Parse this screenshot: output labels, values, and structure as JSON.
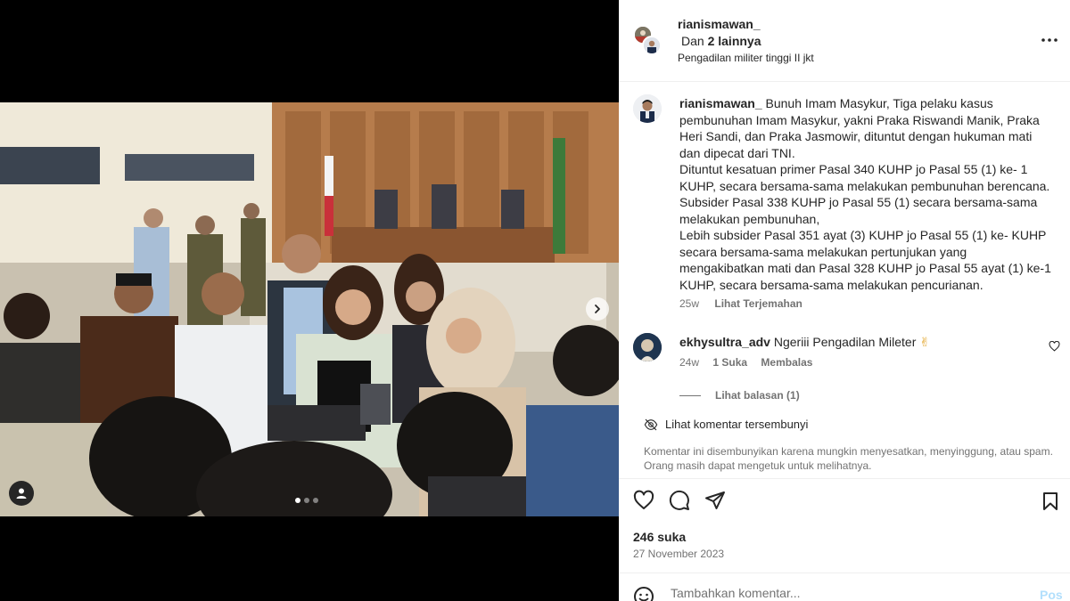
{
  "header": {
    "username": "rianismawan_",
    "others_prefix": "Dan",
    "others_count": "2 lainnya",
    "location": "Pengadilan militer tinggi II jkt",
    "more_icon": "more-horizontal-icon"
  },
  "caption": {
    "username": "rianismawan_",
    "paragraphs": [
      "Bunuh Imam Masykur, Tiga pelaku kasus pembunuhan Imam Masykur, yakni Praka Riswandi Manik, Praka Heri Sandi, dan Praka Jasmowir, dituntut dengan hukuman mati dan dipecat dari TNI.",
      "Dituntut kesatuan primer Pasal 340 KUHP jo Pasal 55 (1) ke- 1 KUHP, secara bersama-sama melakukan pembunuhan berencana. Subsider Pasal 338 KUHP jo Pasal 55 (1) secara bersama-sama melakukan pembunuhan,",
      "Lebih subsider Pasal 351 ayat (3) KUHP jo Pasal 55 (1) ke- KUHP secara bersama-sama melakukan pertunjukan yang mengakibatkan mati dan Pasal 328 KUHP jo Pasal 55 ayat (1) ke-1 KUHP, secara bersama-sama melakukan pencurianan."
    ],
    "time": "25w",
    "translate_label": "Lihat Terjemahan"
  },
  "comment": {
    "username": "ekhysultra_adv",
    "text": "Ngeriii Pengadilan Mileter",
    "emoji": "✌",
    "time": "24w",
    "likes": "1 Suka",
    "reply_label": "Membalas",
    "view_replies": "Lihat balasan (1)"
  },
  "hidden_comments": {
    "label": "Lihat komentar tersembunyi",
    "note": "Komentar ini disembunyikan karena mungkin menyesatkan, menyinggung, atau spam. Orang masih dapat mengetuk untuk melihatnya."
  },
  "post": {
    "likes": "246 suka",
    "date": "27 November 2023"
  },
  "add_comment": {
    "placeholder": "Tambahkan komentar...",
    "post_label": "Pos"
  },
  "carousel": {
    "total": 3,
    "active": 1
  },
  "colors": {
    "primary_text": "#262626",
    "secondary_text": "#737373",
    "post_button_disabled": "#b2dffc",
    "divider": "#efefef"
  }
}
